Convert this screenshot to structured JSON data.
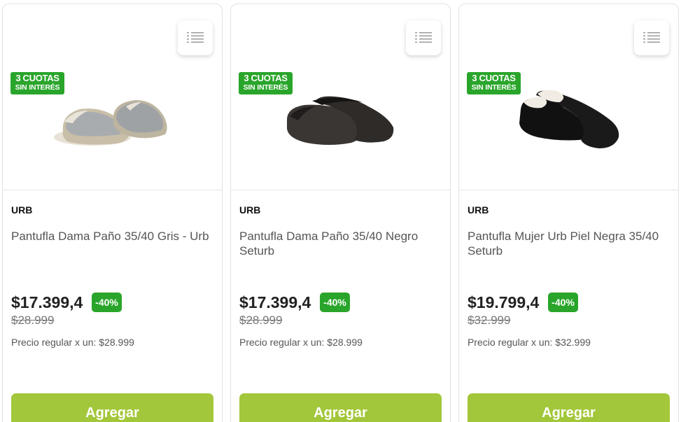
{
  "products": [
    {
      "brand": "URB",
      "title": "Pantufla Dama Paño 35/40 Gris - Urb",
      "price": "$17.399,4",
      "discount": "-40%",
      "old_price": "$28.999",
      "regular": "Precio regular x un: $28.999",
      "badge_line1": "3 CUOTAS",
      "badge_line2": "SIN INTERÉS",
      "add_label": "Agregar",
      "image_icon": "gray-slipper-image"
    },
    {
      "brand": "URB",
      "title": "Pantufla Dama Paño 35/40 Negro Seturb",
      "price": "$17.399,4",
      "discount": "-40%",
      "old_price": "$28.999",
      "regular": "Precio regular x un: $28.999",
      "badge_line1": "3 CUOTAS",
      "badge_line2": "SIN INTERÉS",
      "add_label": "Agregar",
      "image_icon": "dark-slipper-image"
    },
    {
      "brand": "URB",
      "title": "Pantufla Mujer Urb Piel Negra 35/40 Seturb",
      "price": "$19.799,4",
      "discount": "-40%",
      "old_price": "$32.999",
      "regular": "Precio regular x un: $32.999",
      "badge_line1": "3 CUOTAS",
      "badge_line2": "SIN INTERÉS",
      "add_label": "Agregar",
      "image_icon": "black-fur-slipper-image"
    }
  ],
  "colors": {
    "badge_green": "#2aa52b",
    "add_button": "#a3c73a"
  }
}
